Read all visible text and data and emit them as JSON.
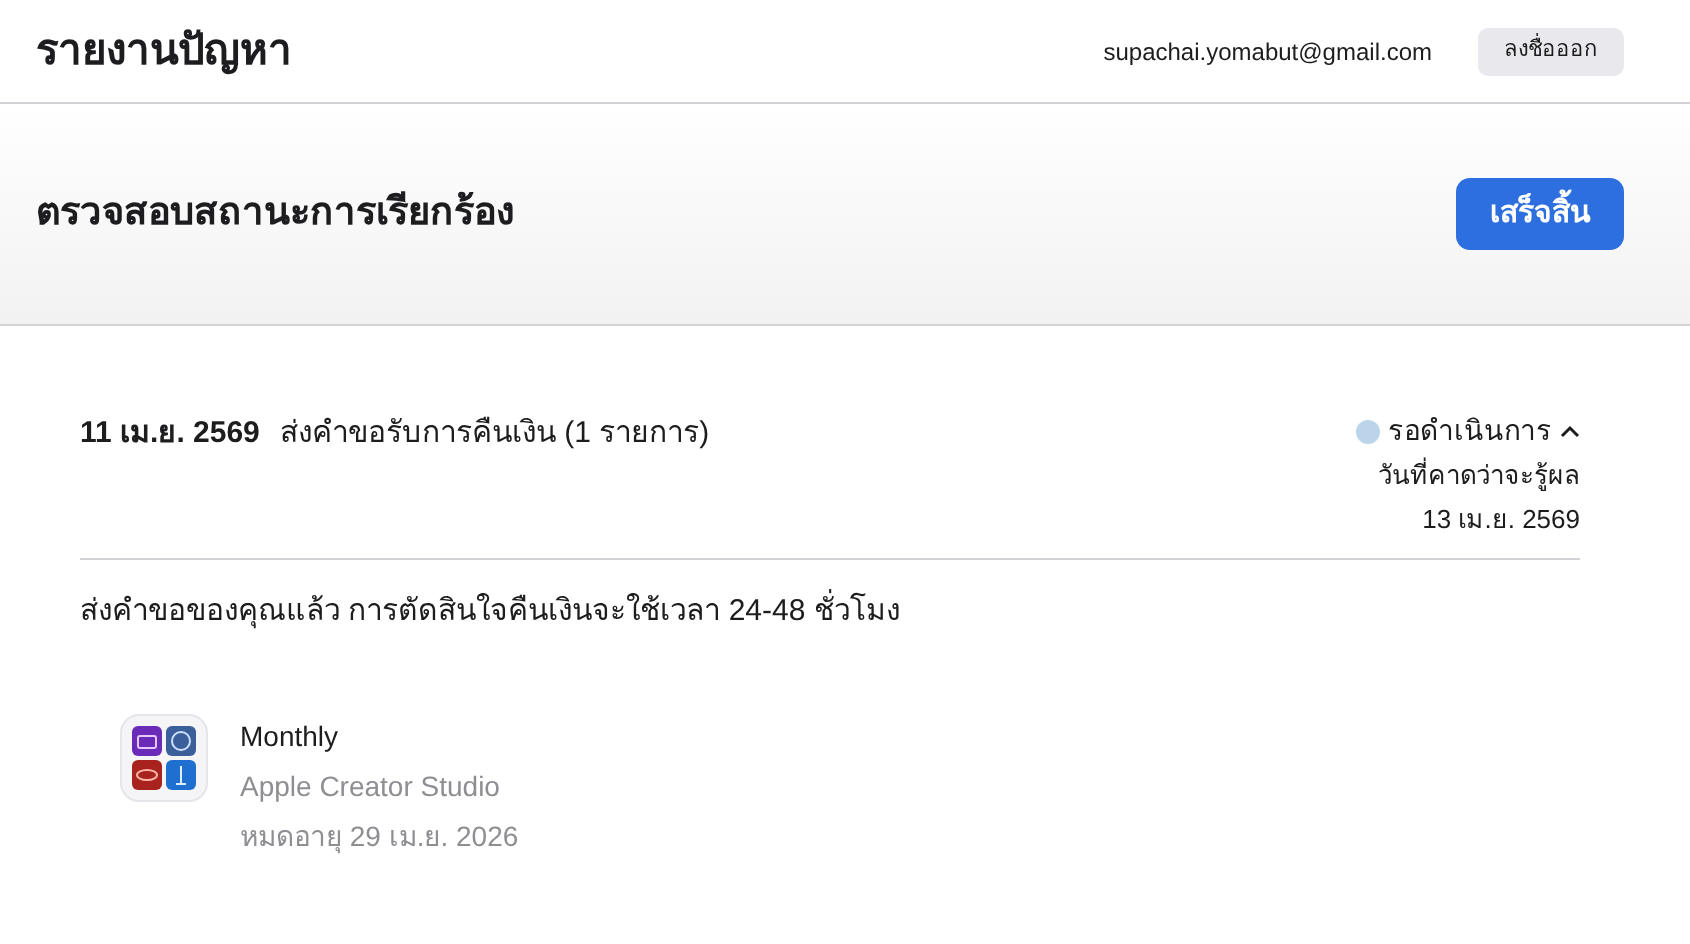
{
  "header": {
    "title": "รายงานปัญหา",
    "email": "supachai.yomabut@gmail.com",
    "sign_out": "ลงชื่อออก"
  },
  "banner": {
    "title": "ตรวจสอบสถานะการเรียกร้อง",
    "done_button": "เสร็จสิ้น"
  },
  "request": {
    "date": "11 เม.ย. 2569",
    "summary": "ส่งคำขอรับการคืนเงิน (1 รายการ)",
    "status": "รอดำเนินการ",
    "expanded": true,
    "eta_label": "วันที่คาดว่าจะรู้ผล",
    "eta_date": "13 เม.ย. 2569",
    "message": "ส่งคำขอของคุณแล้ว การตัดสินใจคืนเงินจะใช้เวลา 24-48 ชั่วโมง",
    "items": [
      {
        "plan": "Monthly",
        "product": "Apple Creator Studio",
        "expiry": "หมดอายุ 29 เม.ย. 2026"
      }
    ]
  }
}
